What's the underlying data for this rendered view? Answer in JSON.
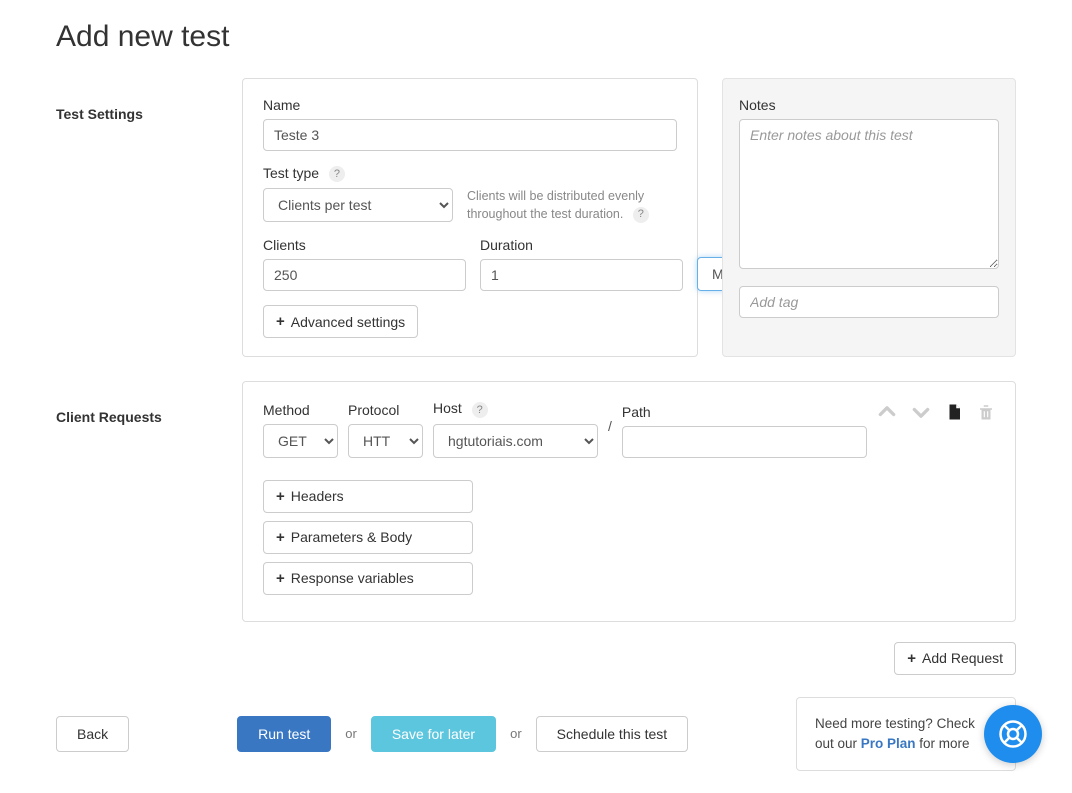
{
  "page_title": "Add new test",
  "sections": {
    "test_settings": "Test Settings",
    "client_requests": "Client Requests"
  },
  "settings": {
    "name_label": "Name",
    "name_value": "Teste 3",
    "test_type_label": "Test type",
    "test_type_value": "Clients per test",
    "test_type_hint": "Clients will be distributed evenly throughout the test duration.",
    "clients_label": "Clients",
    "clients_value": "250",
    "duration_label": "Duration",
    "duration_value": "1",
    "duration_unit": "Min",
    "advanced_btn": "Advanced settings"
  },
  "notes": {
    "label": "Notes",
    "placeholder": "Enter notes about this test",
    "tag_placeholder": "Add tag"
  },
  "request": {
    "method_label": "Method",
    "method_value": "GET",
    "protocol_label": "Protocol",
    "protocol_value": "HTT",
    "host_label": "Host",
    "host_value": "hgtutoriais.com",
    "path_label": "Path",
    "path_value": "",
    "slash": "/",
    "headers_btn": "Headers",
    "params_btn": "Parameters & Body",
    "response_btn": "Response variables"
  },
  "actions": {
    "add_request": "Add Request",
    "back": "Back",
    "run_test": "Run test",
    "save_later": "Save for later",
    "schedule": "Schedule this test",
    "or": "or"
  },
  "promo": {
    "text_before": "Need more testing? Check out our ",
    "link": "Pro Plan",
    "text_after": " for more"
  },
  "help_glyph": "?"
}
